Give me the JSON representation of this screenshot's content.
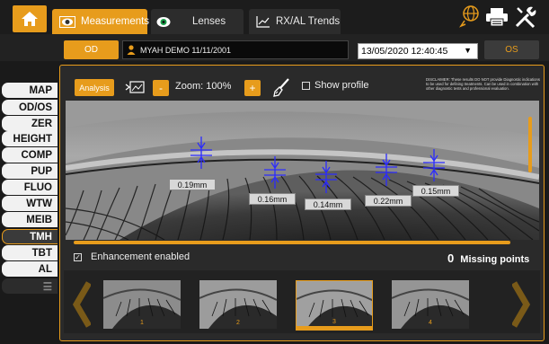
{
  "tabs": {
    "measurements": "Measurements",
    "lenses": "Lenses",
    "trends": "RX/AL Trends"
  },
  "patient": {
    "od_label": "OD",
    "name": "MYAH DEMO 11/11/2001",
    "date": "13/05/2020 12:40:45",
    "os_label": "OS"
  },
  "nav": [
    {
      "label": "MAP"
    },
    {
      "label": "OD/OS"
    },
    {
      "label": "ZER"
    },
    {
      "label": "HEIGHT"
    },
    {
      "label": "COMP"
    },
    {
      "label": "PUP"
    },
    {
      "label": "FLUO"
    },
    {
      "label": "WTW"
    },
    {
      "label": "MEIB"
    },
    {
      "label": "TMH",
      "active": true
    },
    {
      "label": "TBT"
    },
    {
      "label": "AL"
    }
  ],
  "toolbar": {
    "analysis": "Analysis",
    "zoom": "Zoom:  100%",
    "minus": "-",
    "plus": "+",
    "show_profile": "Show profile",
    "disclaimer": "DISCLAIMER: These results DO NOT provide Diagnostic indications to be used for defining treatments. Can be used in combination with other diagnostic tests and professional evaluation."
  },
  "measurements": [
    {
      "label": "0.19mm"
    },
    {
      "label": "0.16mm"
    },
    {
      "label": "0.14mm"
    },
    {
      "label": "0.22mm"
    },
    {
      "label": "0.15mm"
    }
  ],
  "footer": {
    "enhancement": "Enhancement enabled",
    "missing_count": "0",
    "missing_label": "Missing points"
  },
  "thumbnails": [
    {
      "num": "1"
    },
    {
      "num": "2"
    },
    {
      "num": "3",
      "selected": true
    },
    {
      "num": "4"
    }
  ],
  "colors": {
    "accent": "#e79c1c",
    "measure_line": "#2b2bff"
  }
}
